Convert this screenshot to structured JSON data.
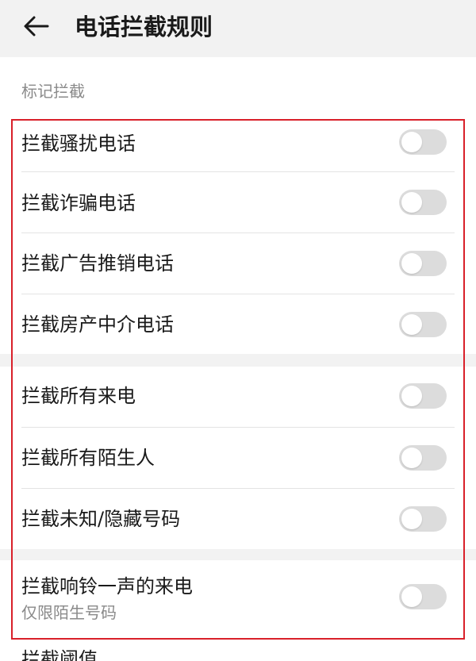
{
  "header": {
    "title": "电话拦截规则",
    "back_icon": "arrow-left-icon"
  },
  "section": {
    "title": "标记拦截"
  },
  "groups": [
    {
      "items": [
        {
          "label": "拦截骚扰电话",
          "enabled": false
        },
        {
          "label": "拦截诈骗电话",
          "enabled": false
        },
        {
          "label": "拦截广告推销电话",
          "enabled": false
        },
        {
          "label": "拦截房产中介电话",
          "enabled": false
        }
      ]
    },
    {
      "items": [
        {
          "label": "拦截所有来电",
          "enabled": false
        },
        {
          "label": "拦截所有陌生人",
          "enabled": false
        },
        {
          "label": "拦截未知/隐藏号码",
          "enabled": false
        }
      ]
    },
    {
      "items": [
        {
          "label": "拦截响铃一声的来电",
          "sublabel": "仅限陌生号码",
          "enabled": false
        }
      ]
    }
  ],
  "partial_item": {
    "label": "拦截阈值"
  },
  "colors": {
    "highlight": "#d9202a",
    "toggle_off": "#dcdcdc",
    "background": "#f2f2f2"
  }
}
